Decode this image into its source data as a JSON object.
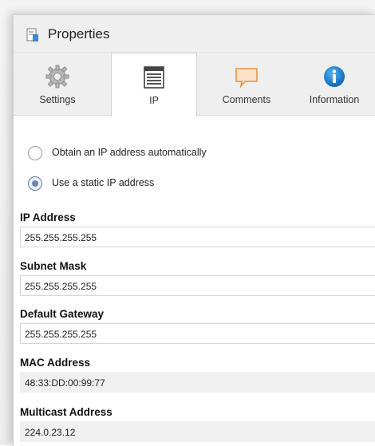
{
  "window": {
    "title": "Properties"
  },
  "tabs": [
    {
      "label": "Settings",
      "icon": "gear-icon"
    },
    {
      "label": "IP",
      "icon": "ip-list-icon"
    },
    {
      "label": "Comments",
      "icon": "comment-icon"
    },
    {
      "label": "Information",
      "icon": "info-icon"
    }
  ],
  "ip_mode": {
    "options": [
      {
        "label": "Obtain an IP address automatically",
        "checked": false
      },
      {
        "label": "Use a static IP address",
        "checked": true
      }
    ]
  },
  "fields": {
    "ip_address": {
      "label": "IP Address",
      "value": "255.255.255.255"
    },
    "subnet_mask": {
      "label": "Subnet Mask",
      "value": "255.255.255.255"
    },
    "default_gateway": {
      "label": "Default Gateway",
      "value": "255.255.255.255"
    },
    "mac_address": {
      "label": "MAC Address",
      "value": "48:33:DD:00:99:77"
    },
    "multicast_address": {
      "label": "Multicast Address",
      "value": "224.0.23.12"
    }
  },
  "colors": {
    "accent": "#1b79c9",
    "comment_icon": "#f2a25a",
    "active_radio": "#6d86a8"
  }
}
